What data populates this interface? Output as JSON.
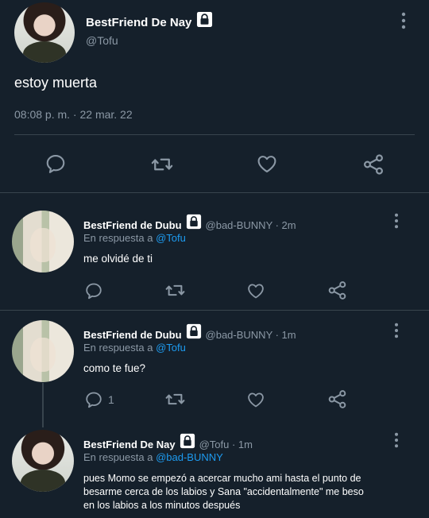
{
  "main_tweet": {
    "name": "BestFriend De Nay",
    "handle": "@Tofu",
    "text": "estoy muerta",
    "timestamp": "08:08 p. m. · 22 mar. 22"
  },
  "replies": [
    {
      "name": "BestFriend de Dubu",
      "handle": "@bad-BUNNY · 2m",
      "reply_prefix": "En respuesta a",
      "reply_to": "@Tofu",
      "text": "me olvidé de ti",
      "reply_count": ""
    },
    {
      "name": "BestFriend de Dubu",
      "handle": "@bad-BUNNY · 1m",
      "reply_prefix": "En respuesta a",
      "reply_to": "@Tofu",
      "text": "como te fue?",
      "reply_count": "1"
    },
    {
      "name": "BestFriend De Nay",
      "handle": "@Tofu · 1m",
      "reply_prefix": "En respuesta a",
      "reply_to": "@bad-BUNNY",
      "text_lines": [
        "pues Momo se empezó a acercar mucho ami hasta el punto de",
        "besarme cerca de los labios y Sana \"accidentalmente\" me beso",
        "en los labios a los minutos después"
      ]
    }
  ],
  "colors": {
    "background": "#15202b",
    "text": "#ffffff",
    "secondary": "#8b98a5",
    "link": "#1d9bf0",
    "divider": "#38444d"
  },
  "icons": [
    "lock-icon",
    "more-icon",
    "reply-icon",
    "retweet-icon",
    "like-icon",
    "share-icon"
  ]
}
